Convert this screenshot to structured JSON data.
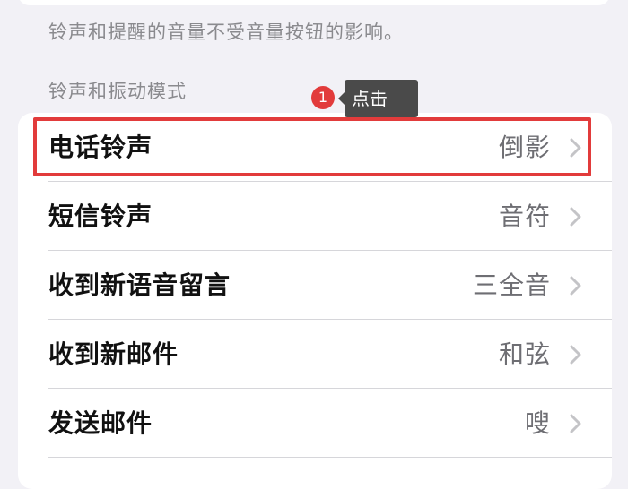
{
  "footnote": "铃声和提醒的音量不受音量按钮的影响。",
  "section_header": "铃声和振动模式",
  "annotation": {
    "step_number": "1",
    "tooltip": "点击",
    "accent_color": "#e23b3b"
  },
  "rows": [
    {
      "label": "电话铃声",
      "value": "倒影",
      "icon": "chevron-right-icon"
    },
    {
      "label": "短信铃声",
      "value": "音符",
      "icon": "chevron-right-icon"
    },
    {
      "label": "收到新语音留言",
      "value": "三全音",
      "icon": "chevron-right-icon"
    },
    {
      "label": "收到新邮件",
      "value": "和弦",
      "icon": "chevron-right-icon"
    },
    {
      "label": "发送邮件",
      "value": "嗖",
      "icon": "chevron-right-icon"
    }
  ]
}
